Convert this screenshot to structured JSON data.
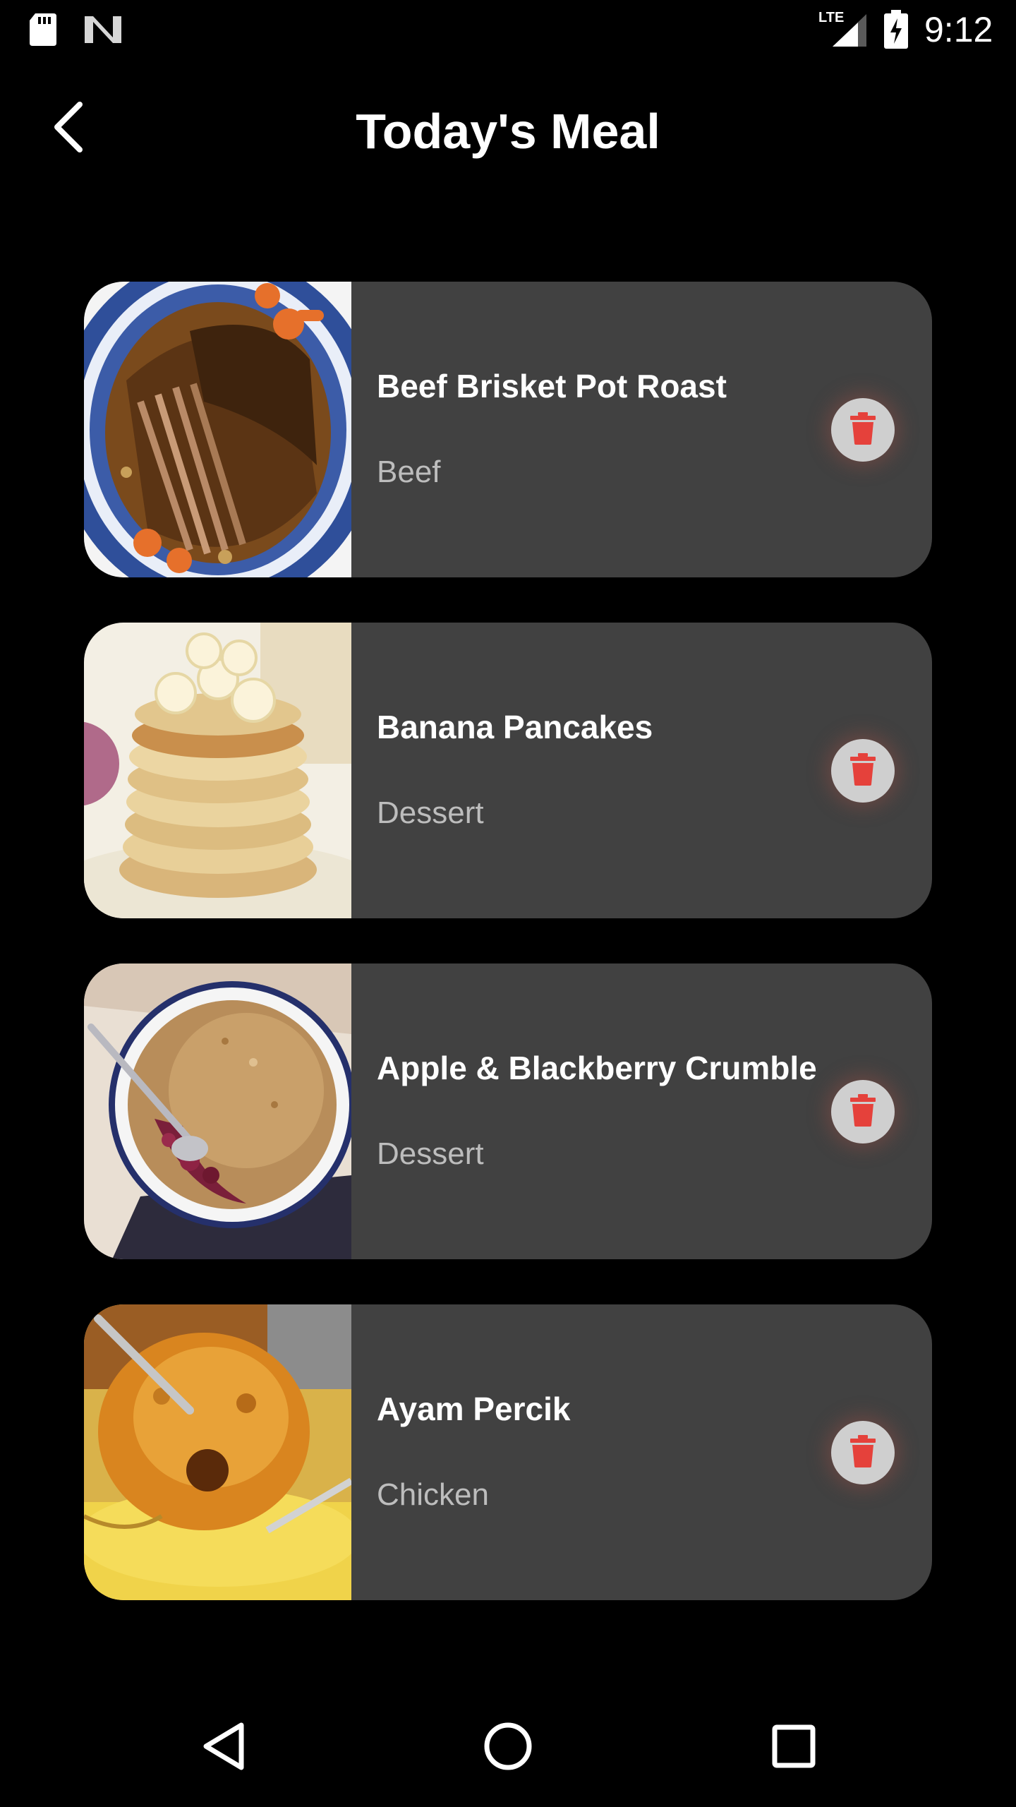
{
  "status_bar": {
    "time": "9:12",
    "network": "LTE",
    "icons": [
      "sd-card-icon",
      "n-notification-icon",
      "lte-signal-icon",
      "battery-charging-icon"
    ]
  },
  "app_bar": {
    "title": "Today's Meal",
    "back_icon": "chevron-left-icon"
  },
  "meals": [
    {
      "name": "Beef Brisket Pot Roast",
      "category": "Beef",
      "thumbnail": "beef-brisket-image",
      "delete_icon": "trash-icon"
    },
    {
      "name": "Banana Pancakes",
      "category": "Dessert",
      "thumbnail": "banana-pancakes-image",
      "delete_icon": "trash-icon"
    },
    {
      "name": "Apple & Blackberry Crumble",
      "category": "Dessert",
      "thumbnail": "crumble-image",
      "delete_icon": "trash-icon"
    },
    {
      "name": "Ayam Percik",
      "category": "Chicken",
      "thumbnail": "ayam-percik-image",
      "delete_icon": "trash-icon"
    }
  ],
  "colors": {
    "background": "#000000",
    "card": "#414141",
    "title_text": "#ffffff",
    "category_text": "#bdbdbd",
    "delete_bg": "#cfcfcf",
    "delete_icon": "#e5413b"
  },
  "nav_bar": {
    "buttons": [
      "nav-back-icon",
      "nav-home-icon",
      "nav-recents-icon"
    ]
  }
}
